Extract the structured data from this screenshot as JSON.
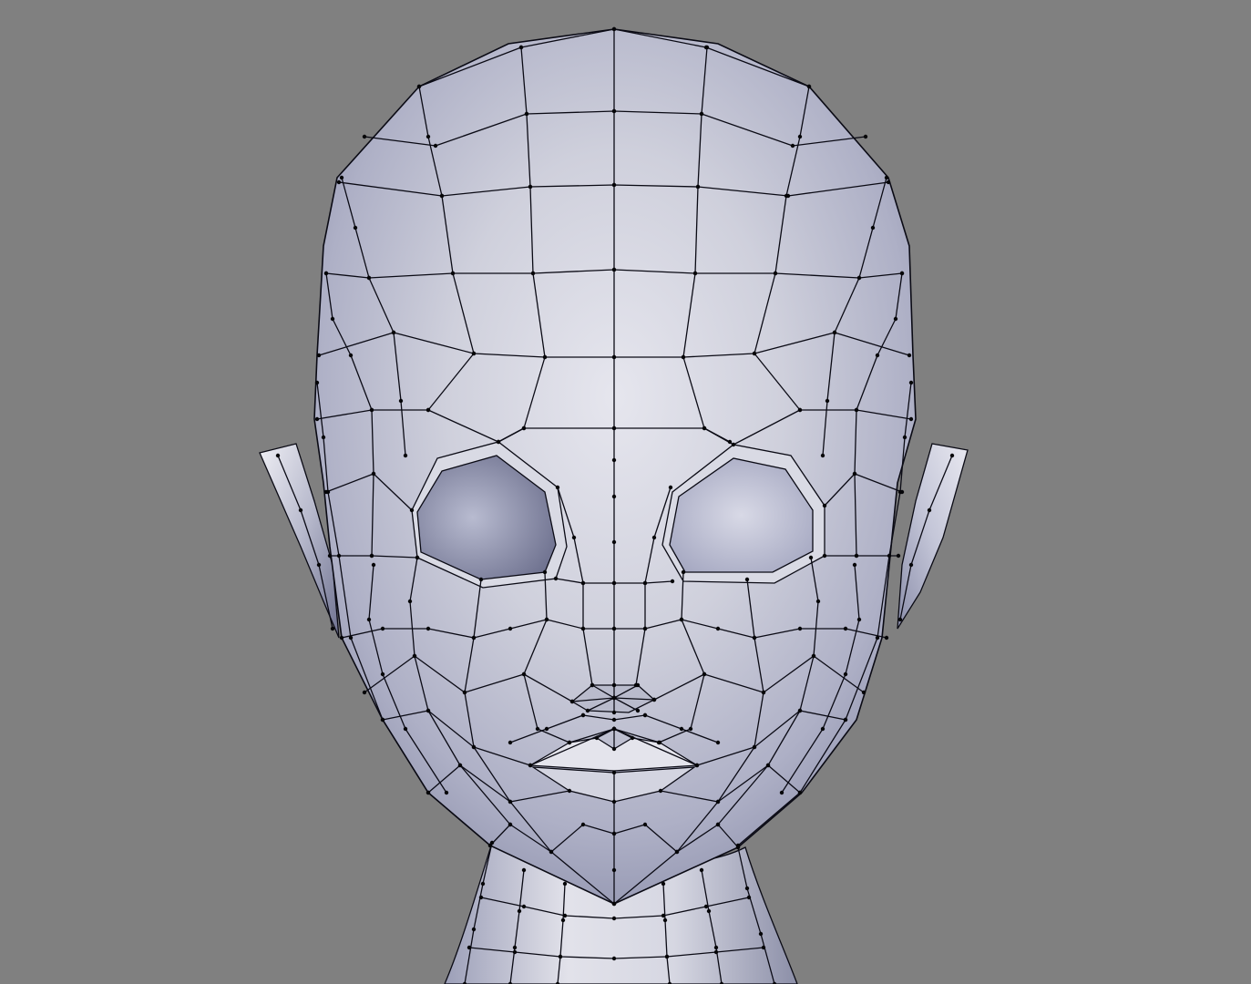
{
  "viewport": {
    "background": "#808080",
    "mesh_color": "#c8c9d6",
    "wire_color": "#0a0a14",
    "mesh": "head-base-mesh"
  }
}
